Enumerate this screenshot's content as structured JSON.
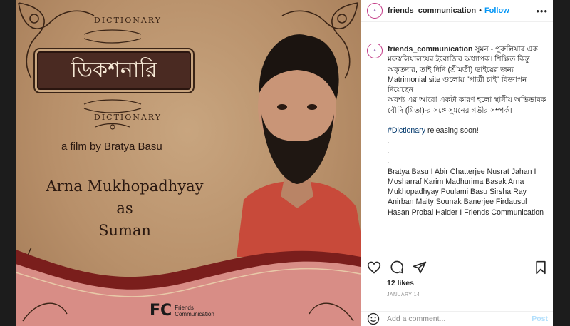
{
  "poster": {
    "dictionary_top": "DICTIONARY",
    "title_bengali": "ডিকশনারি",
    "dictionary_bottom": "DICTIONARY",
    "film_by": "a film by Bratya Basu",
    "actor_line1": "Arna Mukhopadhyay",
    "actor_line2": "as",
    "actor_line3": "Suman",
    "logo_mark": "FC",
    "logo_line1": "Friends",
    "logo_line2": "Communication"
  },
  "header": {
    "username": "friends_communication",
    "separator": "•",
    "follow_label": "Follow",
    "more_icon": "more-horizontal-icon"
  },
  "caption": {
    "username": "friends_communication",
    "line1": "সুমন - পুরুলিয়ার এক মফস্বলিয়ালয়ের ইংরাজির অধ্যাপক। শিক্ষিত কিন্তু অকৃতদার, তাই দিদি (শ্রীমতী) ভাইয়ের জন্য Matrimonial site গুলোয় \"পাত্রী চাই\" বিজ্ঞাপন দিয়েছেন।",
    "line2": "অবশ্য এর আরো একটা কারণ হলো স্থানীয় অভিভাবক বৌদি (মিতা)-র সঙ্গে সুমনের গভীর সম্পর্ক।",
    "hashtag": "#Dictionary",
    "hashtag_rest": " releasing soon!",
    "dot1": ".",
    "dot2": ".",
    "dot3": ".",
    "credits": "Bratya Basu I Abir Chatterjee Nusrat Jahan I Mosharraf Karim Madhurima Basak Arna Mukhopadhyay Poulami Basu Sirsha Ray Anirban Maity Sounak Banerjee Firdausul Hasan Probal Halder I Friends Communication"
  },
  "actions": {
    "like_icon": "heart-icon",
    "comment_icon": "comment-icon",
    "share_icon": "send-icon",
    "save_icon": "bookmark-icon"
  },
  "likes": "12 likes",
  "date": "JANUARY 14",
  "comment": {
    "emoji_icon": "smiley-icon",
    "placeholder": "Add a comment...",
    "post_label": "Post"
  },
  "colors": {
    "follow": "#0095f6",
    "poster_bg": "#b8906a",
    "title_box": "#4a2a22",
    "shirt": "#c84a3a"
  }
}
